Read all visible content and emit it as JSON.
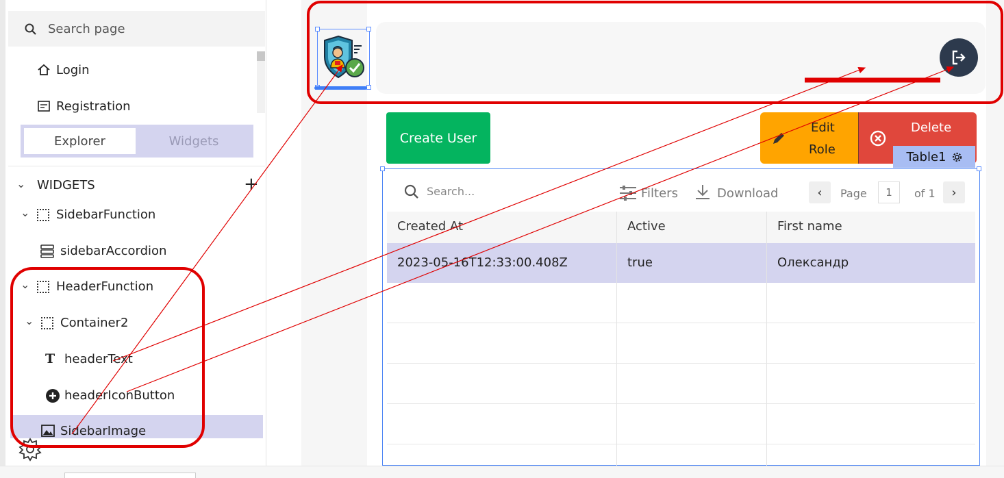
{
  "pages": {
    "search_placeholder": "Search page",
    "items": [
      "Login",
      "Registration"
    ]
  },
  "tabs": [
    "Explorer",
    "Widgets"
  ],
  "widgets": {
    "header": "WIDGETS",
    "add": "+",
    "tree": [
      {
        "label": "SidebarFunction",
        "icon": "container-icon"
      },
      {
        "label": "sidebarAccordion",
        "icon": "accordion-icon"
      },
      {
        "label": "HeaderFunction",
        "icon": "container-icon"
      },
      {
        "label": "Container2",
        "icon": "container-icon"
      },
      {
        "label": "headerText",
        "icon": "text-icon"
      },
      {
        "label": "headerIconButton",
        "icon": "icon-button-icon"
      },
      {
        "label": "SidebarImage",
        "icon": "image-icon"
      }
    ]
  },
  "canvas": {
    "create_user": "Create User",
    "edit_role": [
      "Edit",
      "Role"
    ],
    "delete": "Delete",
    "table_tag": "Table1"
  },
  "table": {
    "search_placeholder": "Search...",
    "filters": "Filters",
    "download": "Download",
    "page_label": "Page",
    "page_value": "1",
    "page_of": "of 1",
    "columns": [
      "Created At",
      "Active",
      "First name"
    ],
    "rows": [
      [
        "2023-05-16T12:33:00.408Z",
        "true",
        "Олександр"
      ]
    ]
  },
  "colors": {
    "annotation_red": "#e00000",
    "create_green": "#04b45f",
    "edit_orange": "#ffa400",
    "delete_red": "#e0473c",
    "selection_blue": "#4d86f5",
    "selected_row": "#d4d4ef"
  }
}
